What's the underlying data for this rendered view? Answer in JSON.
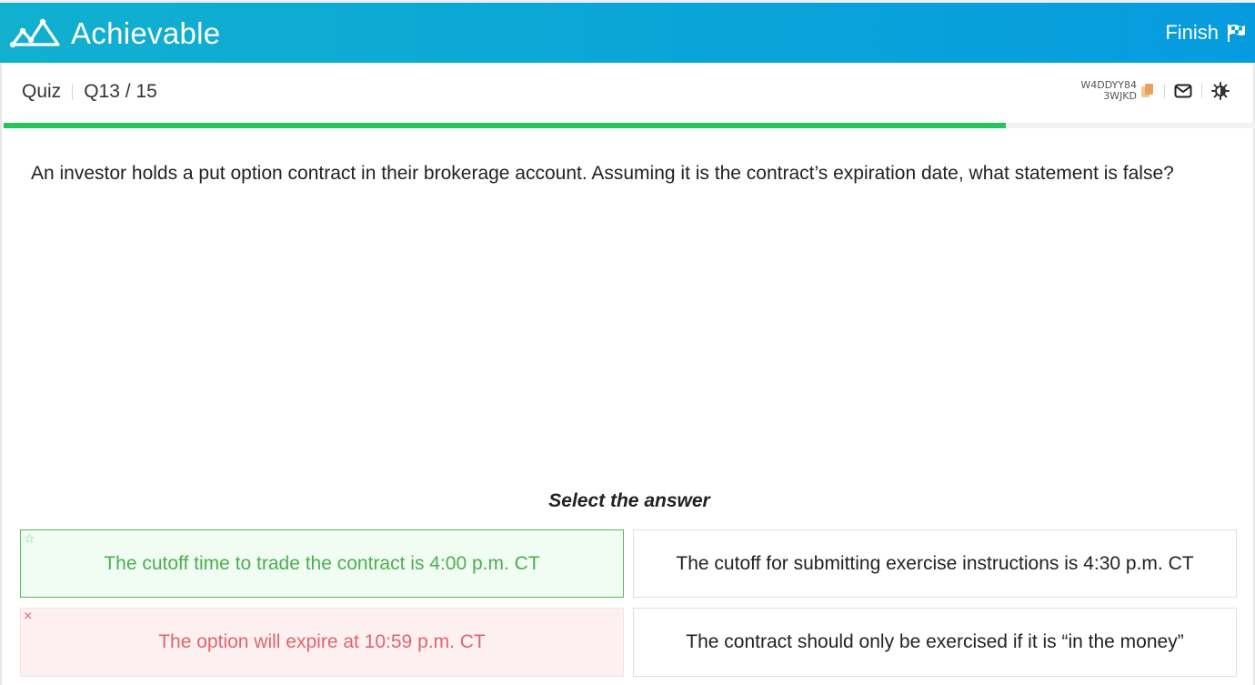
{
  "header": {
    "brand": "Achievable",
    "finish_label": "Finish",
    "logo_icon": "mountain-chart-icon",
    "finish_icon": "checkered-flag-icon",
    "colors": {
      "gradient_start": "#11b0cf",
      "gradient_end": "#069bdf"
    }
  },
  "subheader": {
    "section": "Quiz",
    "position": "Q13 / 15",
    "code_line1": "W4DDYY84",
    "code_line2": "3WJKD",
    "icons": [
      "copy-icon",
      "mail-icon",
      "theme-toggle-icon"
    ]
  },
  "progress": {
    "current": 13,
    "total": 15,
    "fraction": 0.8,
    "color": "#28c35e"
  },
  "question": {
    "text": "An investor holds a put option contract in their brokerage account. Assuming it is the contract’s expiration date, what statement is false?"
  },
  "answers": {
    "prompt": "Select the answer",
    "options": [
      {
        "text": "The cutoff time to trade the contract is 4:00 p.m. CT",
        "state": "correct",
        "marker": "☆"
      },
      {
        "text": "The cutoff for submitting exercise instructions is 4:30 p.m. CT",
        "state": "neutral",
        "marker": ""
      },
      {
        "text": "The option will expire at 10:59 p.m. CT",
        "state": "incorrect",
        "marker": "×"
      },
      {
        "text": "The contract should only be exercised if it is “in the money”",
        "state": "neutral",
        "marker": ""
      }
    ]
  }
}
